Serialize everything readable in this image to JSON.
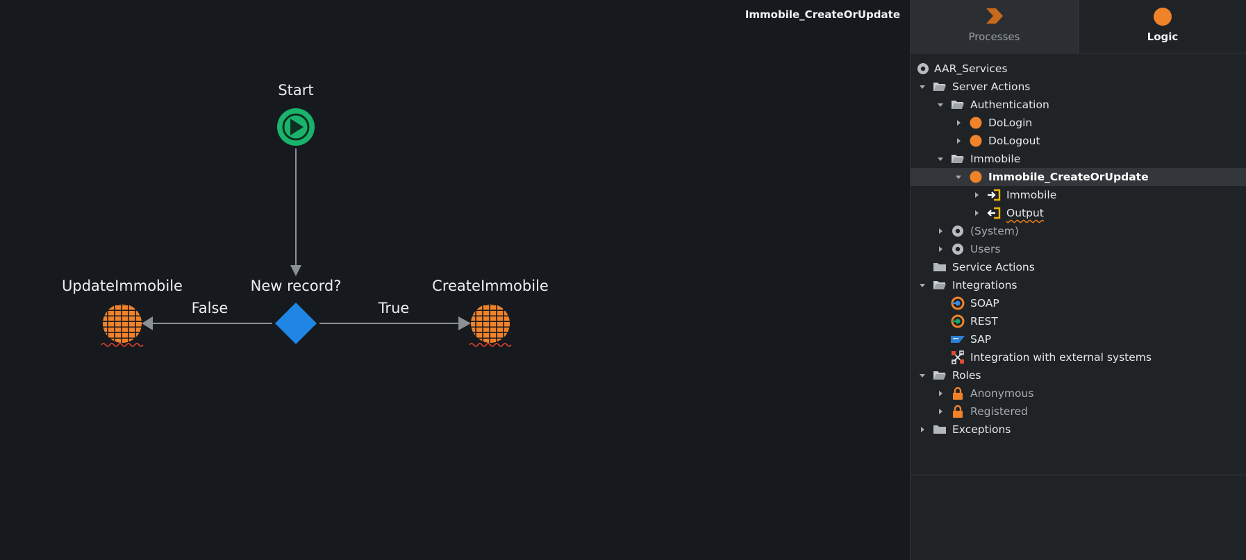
{
  "canvas": {
    "title": "Immobile_CreateOrUpdate",
    "nodes": {
      "start": "Start",
      "decision": "New record?",
      "update": "UpdateImmobile",
      "create": "CreateImmobile"
    },
    "edges": {
      "false_label": "False",
      "true_label": "True"
    }
  },
  "panel": {
    "tabs": [
      {
        "label": "Processes",
        "icon": "process-chevron-icon",
        "active": false
      },
      {
        "label": "Logic",
        "icon": "logic-circle-icon",
        "active": true
      }
    ],
    "tree": [
      {
        "label": "AAR_Services",
        "icon": "module-icon"
      },
      {
        "label": "Server Actions",
        "icon": "folder-open-icon"
      },
      {
        "label": "Authentication",
        "icon": "folder-open-icon"
      },
      {
        "label": "DoLogin",
        "icon": "action-circle-icon"
      },
      {
        "label": "DoLogout",
        "icon": "action-circle-icon"
      },
      {
        "label": "Immobile",
        "icon": "folder-open-icon"
      },
      {
        "label": "Immobile_CreateOrUpdate",
        "icon": "action-circle-icon",
        "selected": true
      },
      {
        "label": "Immobile",
        "icon": "input-parameter-icon"
      },
      {
        "label": "Output",
        "icon": "output-parameter-icon"
      },
      {
        "label": "(System)",
        "icon": "module-icon"
      },
      {
        "label": "Users",
        "icon": "module-icon"
      },
      {
        "label": "Service Actions",
        "icon": "folder-icon"
      },
      {
        "label": "Integrations",
        "icon": "folder-open-icon"
      },
      {
        "label": "SOAP",
        "icon": "soap-icon"
      },
      {
        "label": "REST",
        "icon": "rest-icon"
      },
      {
        "label": "SAP",
        "icon": "sap-icon"
      },
      {
        "label": "Integration with external systems",
        "icon": "integration-icon"
      },
      {
        "label": "Roles",
        "icon": "folder-open-icon"
      },
      {
        "label": "Anonymous",
        "icon": "lock-icon"
      },
      {
        "label": "Registered",
        "icon": "lock-icon"
      },
      {
        "label": "Exceptions",
        "icon": "folder-icon"
      }
    ]
  },
  "colors": {
    "accent_orange": "#f0822a",
    "start_green": "#19b36b",
    "decision_blue": "#1f86e5",
    "selected_row": "#33373b"
  }
}
